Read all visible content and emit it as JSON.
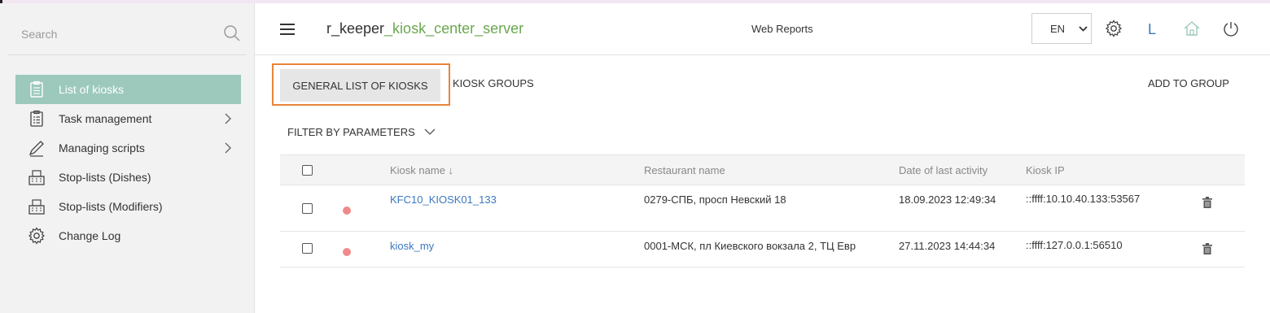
{
  "sidebar": {
    "search_placeholder": "Search",
    "items": [
      {
        "label": "List of kiosks",
        "icon": "clipboard-list-icon",
        "active": true
      },
      {
        "label": "Task management",
        "icon": "clipboard-tasks-icon",
        "has_children": true
      },
      {
        "label": "Managing scripts",
        "icon": "pencil-icon",
        "has_children": true
      },
      {
        "label": "Stop-lists (Dishes)",
        "icon": "cash-register-icon"
      },
      {
        "label": "Stop-lists (Modifiers)",
        "icon": "cash-register-icon"
      },
      {
        "label": "Change Log",
        "icon": "gear-icon"
      }
    ]
  },
  "header": {
    "title_prefix": "r_keeper",
    "title_suffix": "_kiosk_center_server",
    "web_reports": "Web Reports",
    "language": "EN",
    "user_initial": "L",
    "icons": [
      "settings-gear-icon",
      "home-icon",
      "power-icon"
    ]
  },
  "tabs": {
    "general": "GENERAL LIST OF KIOSKS",
    "groups": "KIOSK GROUPS",
    "add_to_group": "ADD TO GROUP"
  },
  "filter": {
    "label": "FILTER BY PARAMETERS"
  },
  "table": {
    "headers": {
      "kiosk_name": "Kiosk name ↓",
      "restaurant": "Restaurant name",
      "last_activity": "Date of last activity",
      "ip": "Kiosk IP"
    },
    "rows": [
      {
        "name": "KFC10_KIOSK01_133",
        "restaurant": "0279-СПБ, просп Невский 18",
        "date": "18.09.2023 12:49:34",
        "ip": "::ffff:10.10.40.133:53567",
        "status": "offline"
      },
      {
        "name": "kiosk_my",
        "restaurant": "0001-МСК, пл Киевского вокзала 2, ТЦ Евр",
        "date": "27.11.2023 14:44:34",
        "ip": "::ffff:127.0.0.1:56510",
        "status": "offline"
      }
    ]
  },
  "colors": {
    "active_nav": "#9cc9bb",
    "accent_green": "#6aa84f",
    "link_blue": "#3b78c0",
    "highlight_orange": "#e8843a",
    "status_dot": "#f08a8a"
  }
}
